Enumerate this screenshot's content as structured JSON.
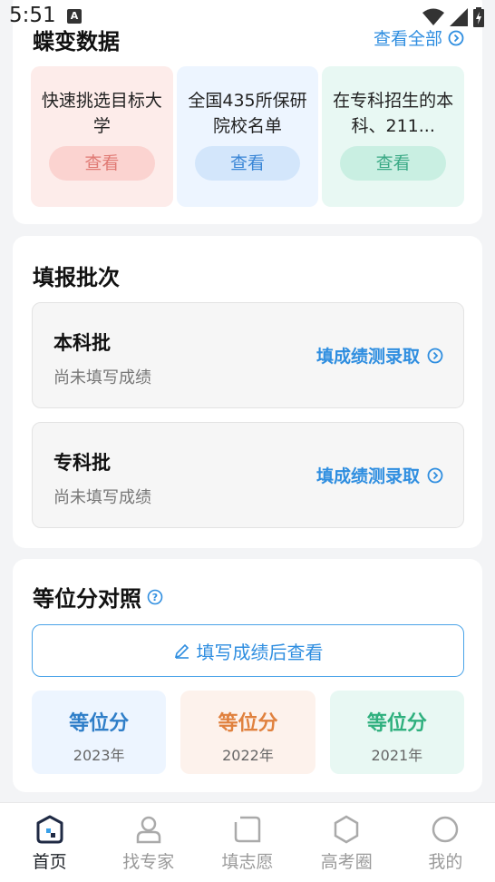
{
  "status_bar": {
    "time": "5:51",
    "notification_icon": "A"
  },
  "mutation_data": {
    "title": "蝶变数据",
    "view_all": "查看全部",
    "tiles": [
      {
        "text": "快速挑选目标大学",
        "button": "查看",
        "accent": "#e07a74"
      },
      {
        "text": "全国435所保研院校名单",
        "button": "查看",
        "accent": "#3a86d6"
      },
      {
        "text": "在专科招生的本科、211...",
        "button": "查看",
        "accent": "#3aa985"
      }
    ]
  },
  "batches": {
    "title": "填报批次",
    "items": [
      {
        "name": "本科批",
        "status": "尚未填写成绩",
        "link": "填成绩测录取"
      },
      {
        "name": "专科批",
        "status": "尚未填写成绩",
        "link": "填成绩测录取"
      }
    ]
  },
  "equivalent": {
    "title": "等位分对照",
    "fill_button": "填写成绩后查看",
    "tiles": [
      {
        "title": "等位分",
        "year": "2023年"
      },
      {
        "title": "等位分",
        "year": "2022年"
      },
      {
        "title": "等位分",
        "year": "2021年"
      }
    ]
  },
  "tabbar": {
    "items": [
      {
        "label": "首页",
        "icon": "home-icon",
        "active": true
      },
      {
        "label": "找专家",
        "icon": "person-icon",
        "active": false
      },
      {
        "label": "填志愿",
        "icon": "square-icon",
        "active": false
      },
      {
        "label": "高考圈",
        "icon": "hexagon-icon",
        "active": false
      },
      {
        "label": "我的",
        "icon": "circle-icon",
        "active": false
      }
    ]
  },
  "colors": {
    "accent": "#2f8ee0",
    "background": "#f3f4f6"
  }
}
